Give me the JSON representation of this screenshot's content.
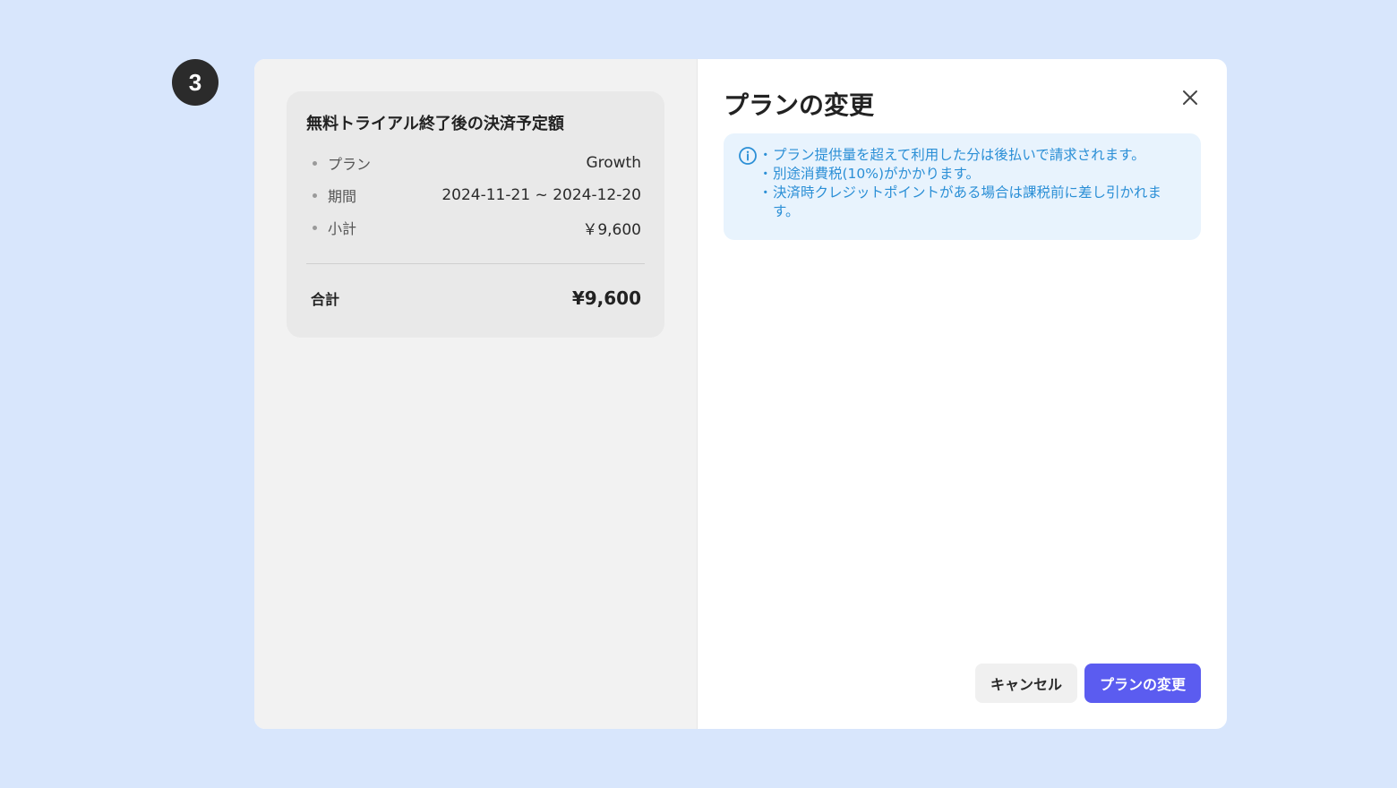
{
  "step": {
    "number": "3"
  },
  "summary": {
    "title": "無料トライアル終了後の決済予定額",
    "rows": [
      {
        "label": "プラン",
        "value": "Growth"
      },
      {
        "label": "期間",
        "value": "2024-11-21 ~ 2024-12-20"
      },
      {
        "label": "小計",
        "value": "￥9,600"
      }
    ],
    "total_label": "合計",
    "total_value": "¥9,600"
  },
  "dialog": {
    "title": "プランの変更",
    "close_icon": "close-icon",
    "info": {
      "icon": "info-icon",
      "lines": [
        "プラン提供量を超えて利用した分は後払いで請求されます。",
        "別途消費税(10%)がかかります。",
        "決済時クレジットポイントがある場合は課税前に差し引かれます。"
      ]
    },
    "cancel_label": "キャンセル",
    "confirm_label": "プランの変更"
  },
  "colors": {
    "background": "#d8e6fc",
    "primary": "#5b5cf0",
    "info_text": "#2b8fd6",
    "info_background": "#e8f3fd"
  }
}
